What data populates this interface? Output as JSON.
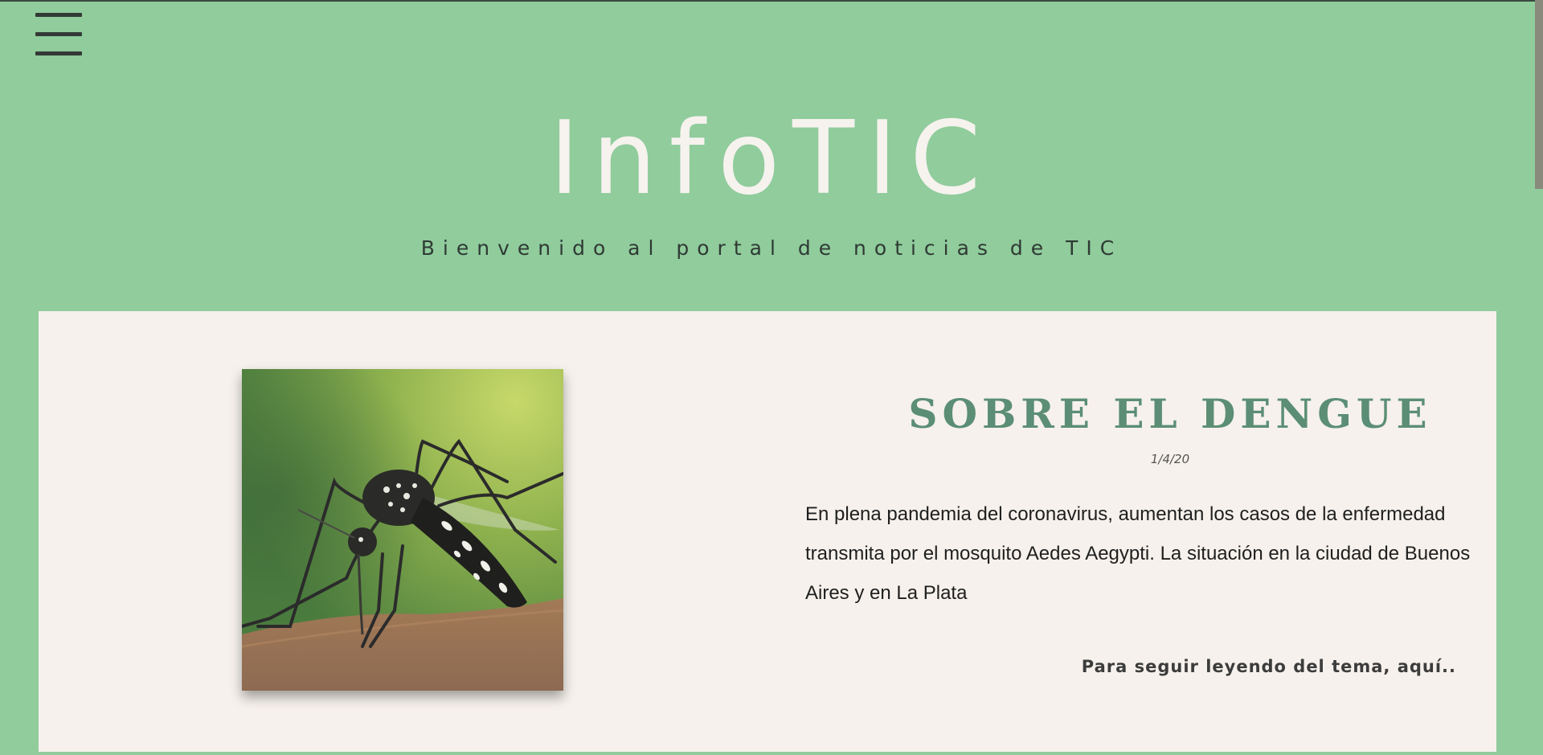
{
  "header": {
    "menu_icon": "hamburger-menu-icon",
    "title": "InfoTIC",
    "subtitle": "Bienvenido al portal de noticias de TIC"
  },
  "article": {
    "image_alt": "mosquito-photo",
    "title": "SOBRE EL DENGUE",
    "date": "1/4/20",
    "body": "En plena pandemia del coronavirus, aumentan los casos de la enfermedad transmita por el mosquito Aedes Aegypti. La situación en la ciudad de Buenos Aires y en La Plata",
    "read_more": "Para seguir leyendo del tema, aquí.."
  },
  "colors": {
    "background": "#90cc9c",
    "card": "#f6f1ec",
    "title_light": "#f6f2ee",
    "article_title": "#5b8e74"
  }
}
